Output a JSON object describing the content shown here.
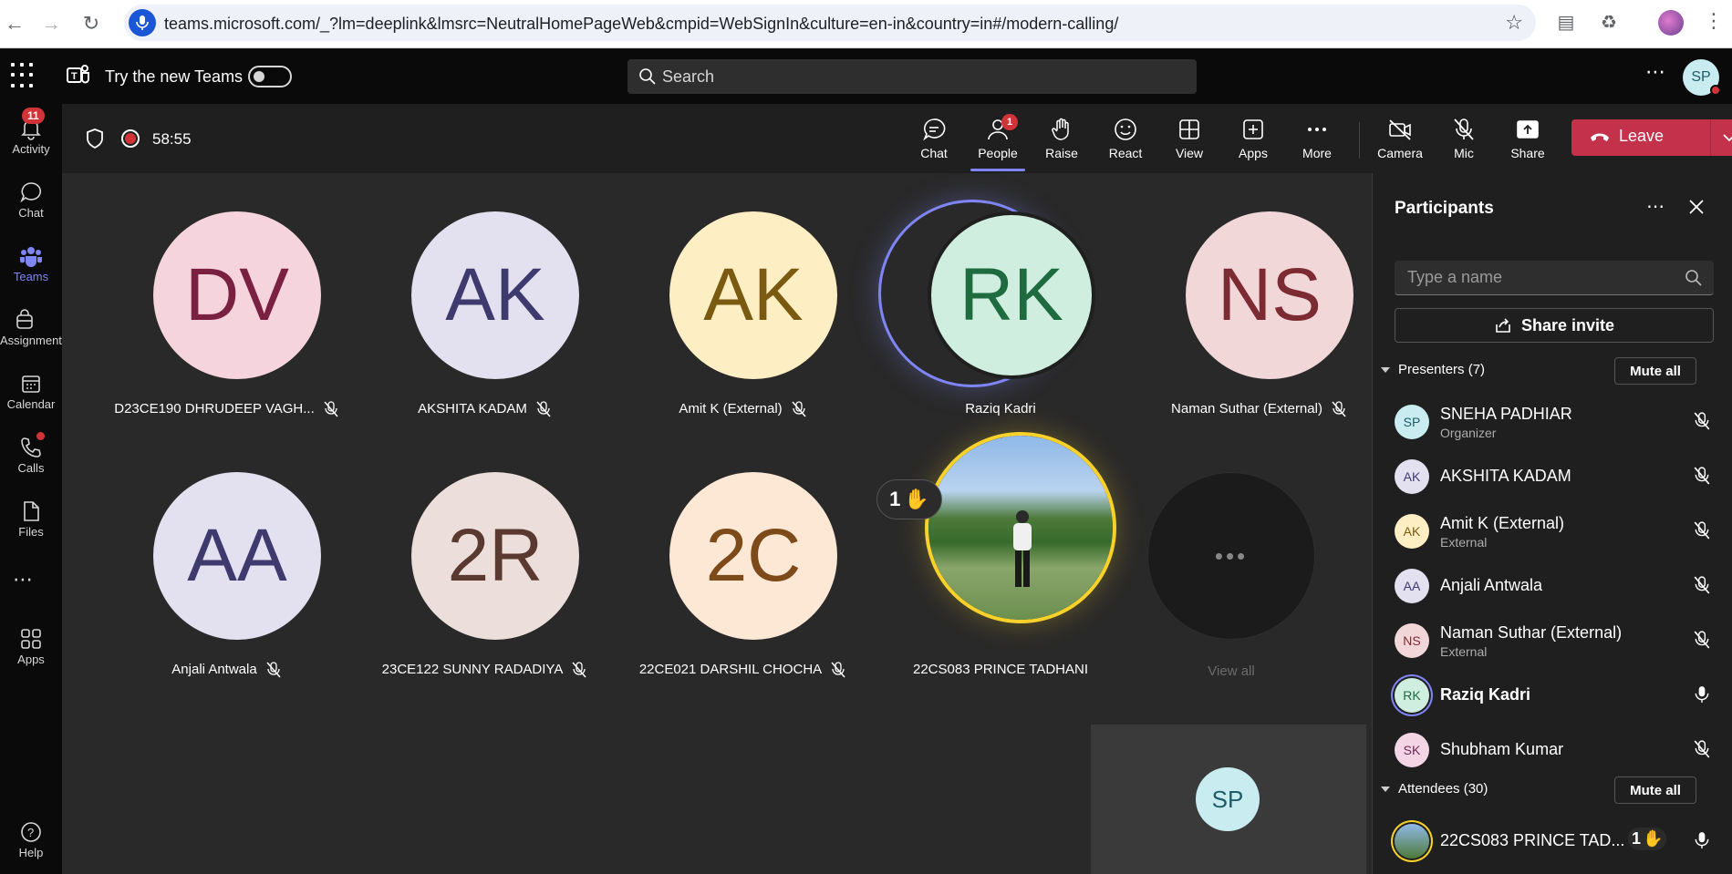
{
  "browser": {
    "url": "teams.microsoft.com/_?lm=deeplink&lmsrc=NeutralHomePageWeb&cmpid=WebSignIn&culture=en-in&country=in#/modern-calling/"
  },
  "topbar": {
    "try_new": "Try the new Teams",
    "search_placeholder": "Search",
    "me_initials": "SP"
  },
  "rail": {
    "items": [
      {
        "label": "Activity",
        "badge": "11"
      },
      {
        "label": "Chat"
      },
      {
        "label": "Teams"
      },
      {
        "label": "Assignments"
      },
      {
        "label": "Calendar"
      },
      {
        "label": "Calls"
      },
      {
        "label": "Files"
      },
      {
        "label": "Apps"
      },
      {
        "label": "Help"
      }
    ]
  },
  "meeting": {
    "timer": "58:55",
    "controls": {
      "chat": "Chat",
      "people": "People",
      "people_badge": "1",
      "raise": "Raise",
      "react": "React",
      "view": "View",
      "apps": "Apps",
      "more": "More",
      "camera": "Camera",
      "mic": "Mic",
      "share": "Share",
      "leave": "Leave"
    }
  },
  "gallery": {
    "tiles": [
      {
        "initials": "DV",
        "name": "D23CE190 DHRUDEEP VAGH...",
        "bg": "#f6d4de",
        "fg": "#7a2040"
      },
      {
        "initials": "AK",
        "name": "AKSHITA KADAM",
        "bg": "#e3e0f0",
        "fg": "#3f3a6e"
      },
      {
        "initials": "AK",
        "name": "Amit K (External)",
        "bg": "#fdeec4",
        "fg": "#7a5a10"
      },
      {
        "initials": "RK",
        "name": "Raziq Kadri",
        "bg": "#cfeedf",
        "fg": "#1e6b40"
      },
      {
        "initials": "NS",
        "name": "Naman Suthar (External)",
        "bg": "#f2d7d9",
        "fg": "#7d2b33"
      },
      {
        "initials": "AA",
        "name": "Anjali Antwala",
        "bg": "#e3e0f0",
        "fg": "#3f3a6e"
      },
      {
        "initials": "2R",
        "name": "23CE122 SUNNY RADADIYA",
        "bg": "#ebdedb",
        "fg": "#5a3a30"
      },
      {
        "initials": "2C",
        "name": "22CE021 DARSHIL CHOCHA",
        "bg": "#fde8d6",
        "fg": "#7d4a1a"
      },
      {
        "initials": "",
        "name": "22CS083 PRINCE TADHANI",
        "bg": "",
        "fg": ""
      }
    ],
    "hand_count": "1",
    "view_all": "View all",
    "self_initials": "SP"
  },
  "panel": {
    "title": "Participants",
    "search_placeholder": "Type a name",
    "share_invite": "Share invite",
    "presenters_label": "Presenters (7)",
    "attendees_label": "Attendees (30)",
    "mute_all": "Mute all",
    "presenters": [
      {
        "initials": "SP",
        "name": "SNEHA PADHIAR",
        "sub": "Organizer",
        "bg": "#c8ecf0",
        "fg": "#1f5c66"
      },
      {
        "initials": "AK",
        "name": "AKSHITA KADAM",
        "sub": "",
        "bg": "#e3e0f0",
        "fg": "#3f3a6e"
      },
      {
        "initials": "AK",
        "name": "Amit K (External)",
        "sub": "External",
        "bg": "#fdeec4",
        "fg": "#7a5a10"
      },
      {
        "initials": "AA",
        "name": "Anjali Antwala",
        "sub": "",
        "bg": "#e3e0f0",
        "fg": "#3f3a6e"
      },
      {
        "initials": "NS",
        "name": "Naman Suthar (External)",
        "sub": "External",
        "bg": "#f2d7d9",
        "fg": "#7d2b33"
      },
      {
        "initials": "RK",
        "name": "Raziq Kadri",
        "sub": "",
        "bg": "#cfeedf",
        "fg": "#1e6b40"
      },
      {
        "initials": "SK",
        "name": "Shubham Kumar",
        "sub": "",
        "bg": "#f3d5e6",
        "fg": "#6d2a55"
      }
    ],
    "attendee_first": {
      "name": "22CS083 PRINCE TAD...",
      "hand": "1"
    }
  },
  "colors": {
    "accent": "#7f85f5",
    "leave": "#c4314b",
    "badge": "#d13438",
    "raised": "#f8d22a"
  }
}
